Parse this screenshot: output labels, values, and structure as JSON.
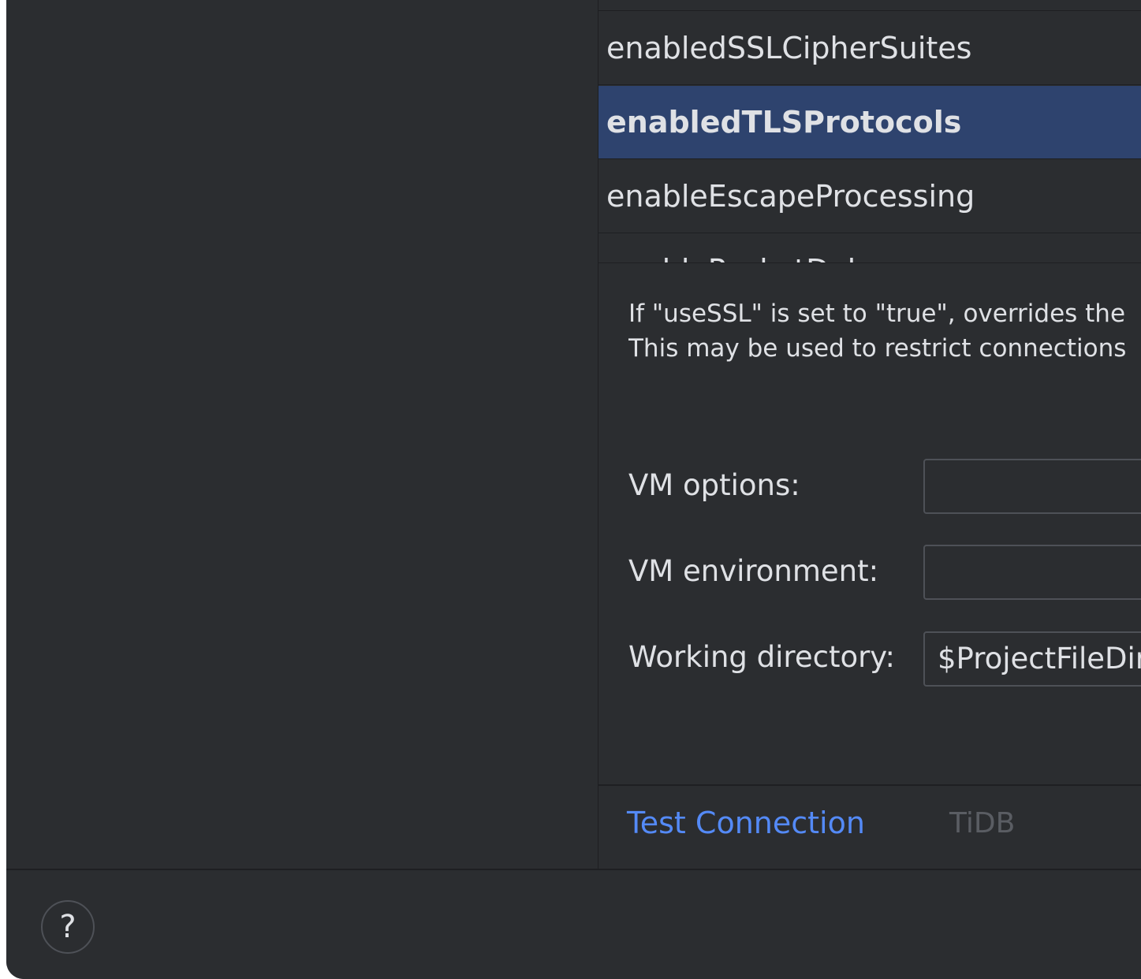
{
  "properties": {
    "items": [
      {
        "label": "enabledSSLCipherSuites",
        "selected": false
      },
      {
        "label": "enabledTLSProtocols",
        "selected": true
      },
      {
        "label": "enableEscapeProcessing",
        "selected": false
      },
      {
        "label": "enablePacketDebug",
        "selected": false
      }
    ]
  },
  "description": {
    "line1": "If \"useSSL\" is set to \"true\", overrides the",
    "line2": "This may be used to restrict connections"
  },
  "form": {
    "vm_options_label": "VM options:",
    "vm_options_value": "",
    "vm_environment_label": "VM environment:",
    "vm_environment_value": "",
    "working_directory_label": "Working directory:",
    "working_directory_value": "$ProjectFileDir$"
  },
  "bottom": {
    "test_connection_label": "Test Connection",
    "driver_label": "TiDB"
  },
  "footer": {
    "help_label": "?"
  },
  "colors": {
    "background": "#2b2d30",
    "selection": "#2e436e",
    "link": "#548af7",
    "text": "#dfe1e5"
  }
}
